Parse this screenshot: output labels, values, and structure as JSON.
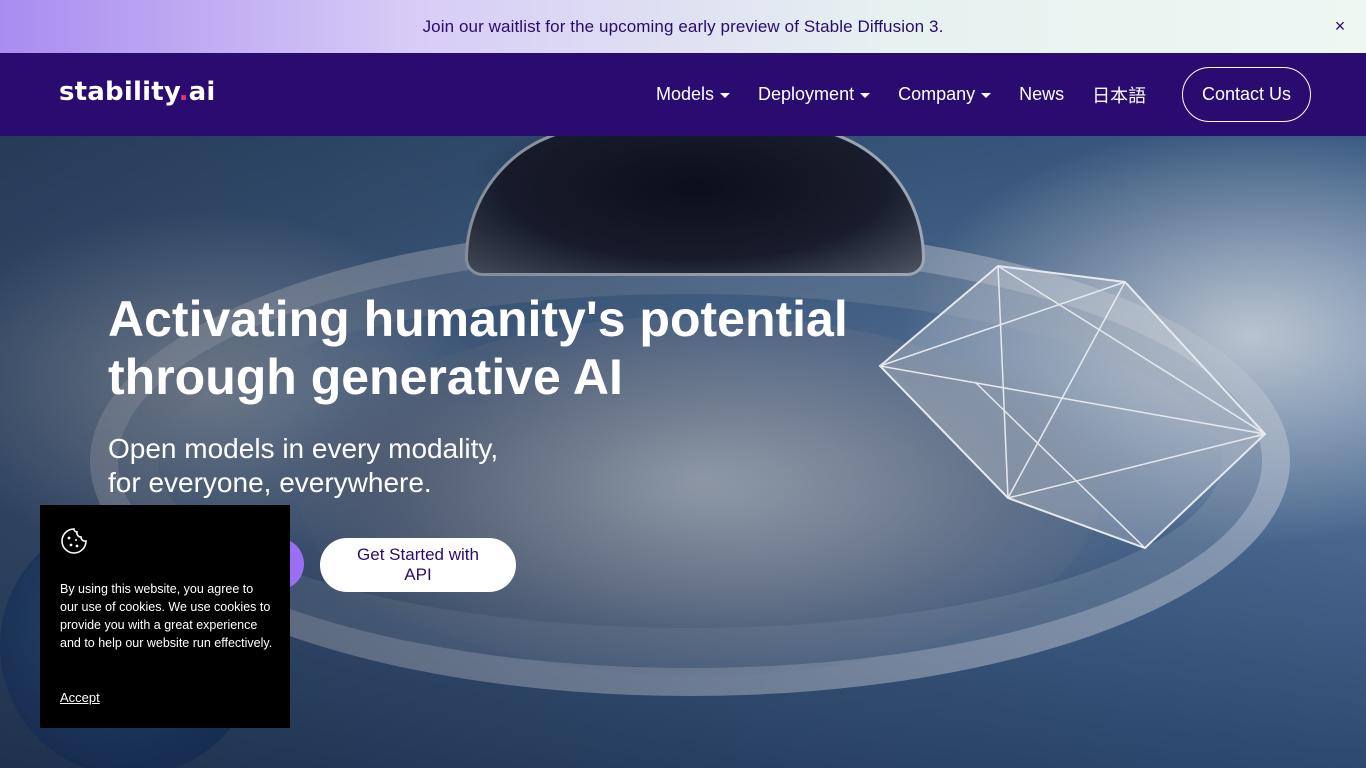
{
  "announcement": {
    "text": "Join our waitlist for the upcoming early preview of Stable Diffusion 3.",
    "close_glyph": "×"
  },
  "header": {
    "logo_main": "stability",
    "logo_dot": ".",
    "logo_suffix": "ai",
    "nav": [
      {
        "label": "Models",
        "has_dropdown": true
      },
      {
        "label": "Deployment",
        "has_dropdown": true
      },
      {
        "label": "Company",
        "has_dropdown": true
      },
      {
        "label": "News",
        "has_dropdown": false
      },
      {
        "label": "日本語",
        "has_dropdown": false
      }
    ],
    "contact_label": "Contact Us"
  },
  "hero": {
    "title_line1": "Activating humanity's potential",
    "title_line2": "through generative AI",
    "subtitle_line1": "Open models in every modality,",
    "subtitle_line2": "for everyone, everywhere.",
    "api_button_label": "Get Started with API"
  },
  "cookie": {
    "text": "By using this website, you agree to our use of cookies. We use cookies to provide you with a great experience and to help our website run effectively.",
    "accept_label": "Accept"
  },
  "colors": {
    "header_bg": "#2a0b6f",
    "accent_purple": "#9b6ef3",
    "announcement_text": "#2a0a6e"
  }
}
